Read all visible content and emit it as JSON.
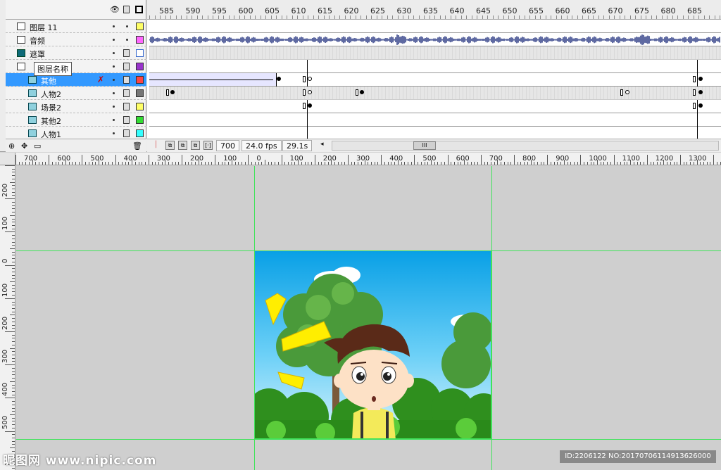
{
  "timeline": {
    "layers": [
      {
        "name": "图层 11",
        "color": "#ffff66",
        "type": "normal"
      },
      {
        "name": "音频",
        "color": "#ff66ff",
        "type": "normal"
      },
      {
        "name": "遮罩",
        "color": "#ffffff",
        "type": "mask"
      },
      {
        "name": "",
        "color": "#9933cc",
        "type": "normal"
      },
      {
        "name": "其他",
        "color": "#ff4444",
        "type": "masked",
        "selected": true
      },
      {
        "name": "人物2",
        "color": "#777777",
        "type": "masked"
      },
      {
        "name": "场景2",
        "color": "#ffff66",
        "type": "masked"
      },
      {
        "name": "其他2",
        "color": "#33dd33",
        "type": "masked"
      },
      {
        "name": "人物1",
        "color": "#33ffff",
        "type": "masked"
      }
    ],
    "tooltip": "图层名称",
    "frame_ruler": [
      "585",
      "590",
      "595",
      "600",
      "605",
      "610",
      "615",
      "620",
      "625",
      "630",
      "635",
      "640",
      "645",
      "650",
      "655",
      "660",
      "665",
      "670",
      "675",
      "680",
      "685"
    ],
    "status": {
      "current_frame": "700",
      "fps": "24.0 fps",
      "elapsed": "29.1s"
    }
  },
  "stage": {
    "h_ruler": [
      "700",
      "600",
      "500",
      "400",
      "300",
      "200",
      "100",
      "0",
      "100",
      "200",
      "300",
      "400",
      "500",
      "600",
      "700",
      "800",
      "900",
      "1000",
      "1100",
      "1200",
      "1300"
    ],
    "v_ruler": [
      "200",
      "100",
      "0",
      "100",
      "200",
      "300",
      "400",
      "500"
    ]
  },
  "colors": {
    "selection": "#3399ff",
    "guide": "#3fe35a",
    "sky": "#1aa7e8"
  },
  "watermark": {
    "left": "昵图网 www.nipic.com",
    "right": "ID:2206122 NO:20170706114913626000"
  }
}
